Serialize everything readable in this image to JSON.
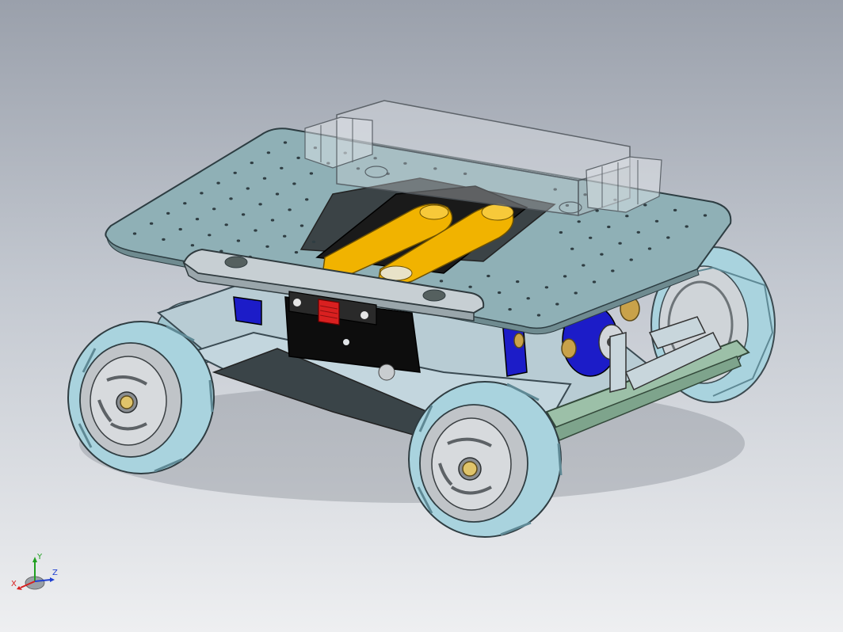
{
  "viewport": {
    "background_top": "#9aa0ab",
    "background_bottom": "#eeeff1"
  },
  "model": {
    "plate_color": "#8fb0b6",
    "frame_color": "#b8ccd4",
    "wheel_color": "#a9d3de",
    "hub_color": "#b9bcc0",
    "battery_color": "#f1b300",
    "motor_color": "#1c1cc8",
    "switch_color": "#d92020",
    "transparent_part_color": "#d8dde2"
  },
  "triad": {
    "x_label": "X",
    "y_label": "Y",
    "z_label": "Z",
    "x_color": "#d62020",
    "y_color": "#20a020",
    "z_color": "#2040d0"
  }
}
